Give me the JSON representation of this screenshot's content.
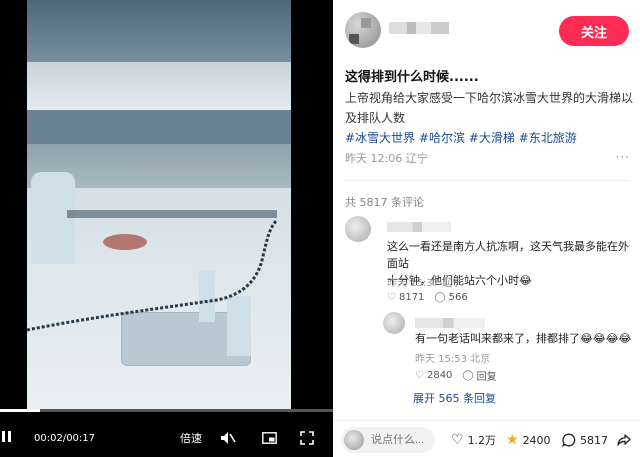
{
  "video": {
    "time_display": "00:02/00:17",
    "speed_label": "倍速",
    "progress": 0.12
  },
  "post": {
    "follow_label": "关注",
    "title": "这得排到什么时候......",
    "body": "上帝视角给大家感受一下哈尔滨冰雪大世界的大滑梯以及排队人数",
    "hashtags": [
      "#冰雪大世界",
      "#哈尔滨",
      "#大滑梯",
      "#东北旅游"
    ],
    "meta": "昨天 12:06 辽宁",
    "more": "···"
  },
  "comments": {
    "count_label": "共 5817 条评论",
    "items": [
      {
        "text_line1": "这么一看还是南方人抗冻啊，这天气我最多能在外面站",
        "text_line2": "十分钟，他们能站六个小时😂",
        "meta": "昨天 15:37 辽宁",
        "likes": "8171",
        "replies": "566"
      },
      {
        "text": "有一句老话叫来都来了，排都排了😂😂😂😂",
        "meta": "昨天 15:53 北京",
        "likes": "2840",
        "reply_label": "回复"
      }
    ],
    "expand_label": "展开 565 条回复"
  },
  "bottom_bar": {
    "input_placeholder": "说点什么...",
    "likes": "1.2万",
    "favorites": "2400",
    "comments": "5817"
  },
  "icons": {
    "like": "heart-outline-icon",
    "favorite": "star-icon",
    "comment": "comment-bubble-icon",
    "share": "share-arrow-icon"
  },
  "colors": {
    "follow_button": "#fe2c55",
    "hashtag": "#1a4a8c",
    "favorite_star": "#f5a623"
  }
}
